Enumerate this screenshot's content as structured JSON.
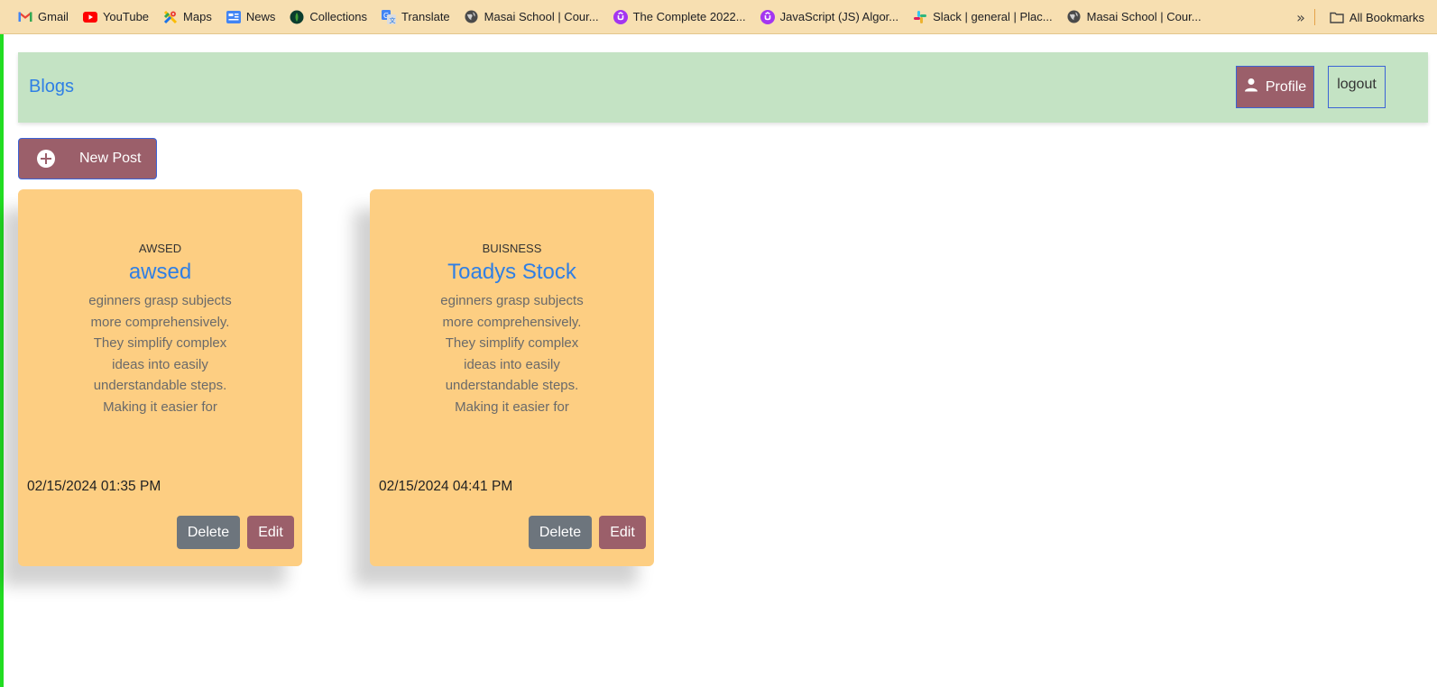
{
  "bookmarks": {
    "items": [
      {
        "label": "Gmail",
        "icon": "gmail-icon"
      },
      {
        "label": "YouTube",
        "icon": "youtube-icon"
      },
      {
        "label": "Maps",
        "icon": "maps-icon"
      },
      {
        "label": "News",
        "icon": "news-icon"
      },
      {
        "label": "Collections",
        "icon": "collections-icon"
      },
      {
        "label": "Translate",
        "icon": "translate-icon"
      },
      {
        "label": "Masai School | Cour...",
        "icon": "globe-icon"
      },
      {
        "label": "The Complete 2022...",
        "icon": "udemy-icon"
      },
      {
        "label": "JavaScript (JS) Algor...",
        "icon": "udemy-icon"
      },
      {
        "label": "Slack | general | Plac...",
        "icon": "slack-icon"
      },
      {
        "label": "Masai School | Cour...",
        "icon": "globe-icon"
      }
    ],
    "more_label": "»",
    "all_bookmarks_label": "All Bookmarks"
  },
  "navbar": {
    "brand": "Blogs",
    "profile_label": "Profile",
    "logout_label": "logout"
  },
  "new_post_label": "New Post",
  "posts": [
    {
      "category": "AWSED",
      "title": "awsed",
      "body": "eginners grasp subjects more comprehensively. They simplify complex ideas into easily understandable steps. Making it easier for",
      "date": "02/15/2024 01:35 PM",
      "delete_label": "Delete",
      "edit_label": "Edit"
    },
    {
      "category": "BUISNESS",
      "title": "Toadys Stock",
      "body": "eginners grasp subjects more comprehensively. They simplify complex ideas into easily understandable steps. Making it easier for",
      "date": "02/15/2024 04:41 PM",
      "delete_label": "Delete",
      "edit_label": "Edit"
    }
  ],
  "colors": {
    "bookmarks_bg": "#f7dfb1",
    "navbar_bg": "#c4e3c4",
    "brand_blue": "#2f7fe5",
    "accent_mauve": "#9b5f6a",
    "card_bg": "#fdce82",
    "delete_gray": "#6d757d"
  }
}
